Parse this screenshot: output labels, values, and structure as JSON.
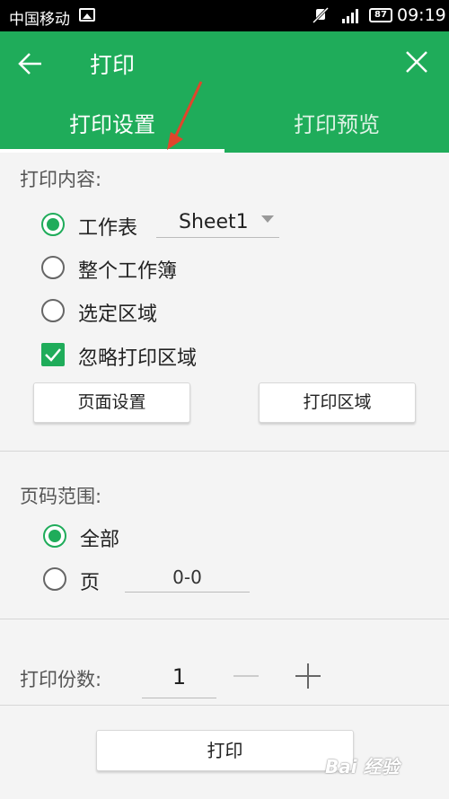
{
  "status_bar": {
    "carrier": "中国移动",
    "battery": "87",
    "time": "09:19"
  },
  "header": {
    "title": "打印",
    "tabs": [
      {
        "label": "打印设置",
        "active": true
      },
      {
        "label": "打印预览",
        "active": false
      }
    ]
  },
  "print_content": {
    "label": "打印内容:",
    "options": [
      {
        "label": "工作表",
        "checked": true
      },
      {
        "label": "整个工作簿",
        "checked": false
      },
      {
        "label": "选定区域",
        "checked": false
      }
    ],
    "sheet_select": "Sheet1",
    "ignore_area": {
      "label": "忽略打印区域",
      "checked": true
    },
    "page_setup_button": "页面设置",
    "print_area_button": "打印区域"
  },
  "page_range": {
    "label": "页码范围:",
    "options": [
      {
        "label": "全部",
        "checked": true
      },
      {
        "label": "页",
        "checked": false
      }
    ],
    "page_value": "0-0"
  },
  "copies": {
    "label": "打印份数:",
    "value": "1"
  },
  "print_button": "打印",
  "watermark": "Bai 经验",
  "colors": {
    "accent": "#1fac5a",
    "annotation_arrow": "#e0452c"
  },
  "icons": [
    "back-arrow-icon",
    "close-icon",
    "minus-icon",
    "plus-icon",
    "checkmark-icon",
    "signal-icon",
    "mute-icon",
    "image-icon"
  ]
}
